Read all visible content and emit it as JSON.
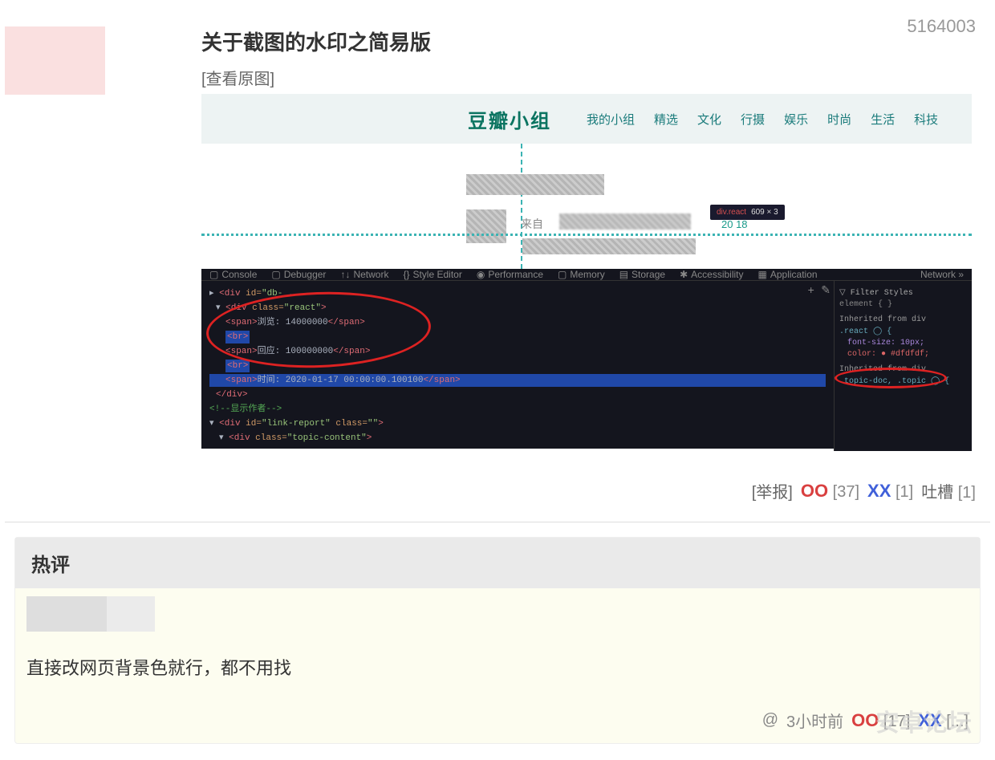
{
  "post": {
    "id": "5164003",
    "title": "关于截图的水印之简易版",
    "view_original": "[查看原图]"
  },
  "screenshot_nav": {
    "logo": "豆瓣小组",
    "items": [
      "我的小组",
      "精选",
      "文化",
      "行摄",
      "娱乐",
      "时尚",
      "生活",
      "科技"
    ]
  },
  "screenshot_meta": {
    "from": "来自",
    "date_fragment": "20                 18",
    "tooltip": "div.react"
  },
  "devtools": {
    "tabs": [
      "Console",
      "Debugger",
      "Network",
      "Style Editor",
      "Performance",
      "Memory",
      "Storage",
      "Accessibility",
      "Application"
    ],
    "network_link": "Network »",
    "filter": "Filter Styles",
    "styles": {
      "element": "element { }",
      "inherited1": "Inherited from div",
      "rule": ".react ◯ {",
      "prop1": "font-size: 10px;",
      "prop2": "color: ● #dfdfdf;",
      "inherited2": "Inherited from div"
    }
  },
  "actions": {
    "report": "[举报]",
    "oo": "OO",
    "oo_count": "[37]",
    "xx": "XX",
    "xx_count": "[1]",
    "tucao": "吐槽",
    "tucao_count": "[1]"
  },
  "hot_comment": {
    "header": "热评",
    "text": "直接改网页背景色就行，都不用找",
    "at": "@",
    "time": "3小时前",
    "oo": "OO",
    "oo_count": "[17]",
    "xx": "XX",
    "xx_count": "[...]"
  },
  "watermark": "安卓论坛"
}
